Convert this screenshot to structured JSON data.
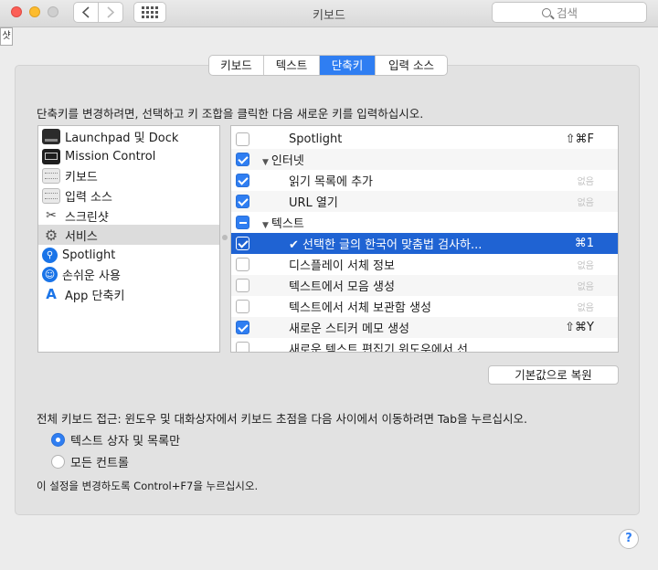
{
  "window": {
    "title": "키보드",
    "search_placeholder": "검색",
    "tooltip_fragment": "샷"
  },
  "tabs": [
    {
      "label": "키보드",
      "active": false
    },
    {
      "label": "텍스트",
      "active": false
    },
    {
      "label": "단축키",
      "active": true
    },
    {
      "label": "입력 소스",
      "active": false
    }
  ],
  "instruction": "단축키를 변경하려면, 선택하고 키 조합을 클릭한 다음 새로운 키를 입력하십시오.",
  "categories": [
    {
      "label": "Launchpad 및 Dock",
      "icon": "launchpad-icon"
    },
    {
      "label": "Mission Control",
      "icon": "mission-control-icon"
    },
    {
      "label": "키보드",
      "icon": "keyboard-icon"
    },
    {
      "label": "입력 소스",
      "icon": "keyboard-icon"
    },
    {
      "label": "스크린샷",
      "icon": "screenshot-icon"
    },
    {
      "label": "서비스",
      "icon": "gear-icon",
      "selected": true
    },
    {
      "label": "Spotlight",
      "icon": "spotlight-icon"
    },
    {
      "label": "손쉬운 사용",
      "icon": "accessibility-icon"
    },
    {
      "label": "App 단축키",
      "icon": "app-store-icon"
    }
  ],
  "shortcuts": [
    {
      "type": "item",
      "checked": false,
      "label": "Spotlight",
      "keys": "⇧⌘F"
    },
    {
      "type": "group",
      "checked": true,
      "label": "인터넷"
    },
    {
      "type": "item",
      "checked": true,
      "label": "읽기 목록에 추가",
      "keys": "없음"
    },
    {
      "type": "item",
      "checked": true,
      "label": "URL 열기",
      "keys": "없음"
    },
    {
      "type": "group",
      "checked": "mixed",
      "label": "텍스트"
    },
    {
      "type": "item",
      "checked": true,
      "selected": true,
      "label": "✔ 선택한 글의 한국어 맞춤법 검사하...",
      "keys": "⌘1"
    },
    {
      "type": "item",
      "checked": false,
      "label": "디스플레이 서체 정보",
      "keys": "없음"
    },
    {
      "type": "item",
      "checked": false,
      "label": "텍스트에서 모음 생성",
      "keys": "없음"
    },
    {
      "type": "item",
      "checked": false,
      "label": "텍스트에서 서체 보관함 생성",
      "keys": "없음"
    },
    {
      "type": "item",
      "checked": true,
      "label": "새로운 스티커 메모 생성",
      "keys": "⇧⌘Y"
    },
    {
      "type": "item",
      "checked": false,
      "label": "새로운 텍스트 편집기 윈도우에서 선...",
      "keys": ""
    }
  ],
  "restore_button": "기본값으로 복원",
  "full_keyboard": {
    "label": "전체 키보드 접근: 윈도우 및 대화상자에서 키보드 초점을 다음 사이에서 이동하려면 Tab을 누르십시오.",
    "options": [
      {
        "label": "텍스트 상자 및 목록만",
        "selected": true
      },
      {
        "label": "모든 컨트롤",
        "selected": false
      }
    ],
    "hint": "이 설정을 변경하도록 Control+F7을 누르십시오."
  },
  "help_label": "?"
}
